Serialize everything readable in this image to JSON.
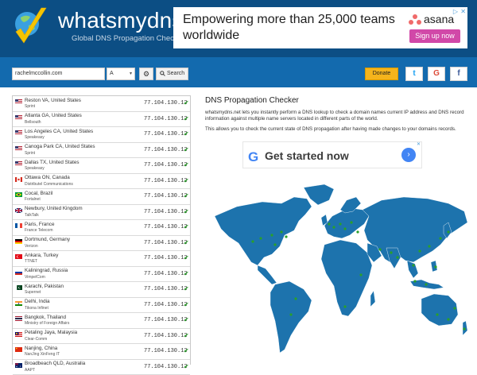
{
  "site": {
    "title": "whatsmydns.net",
    "subtitle": "Global DNS Propagation Checker"
  },
  "ad_top": {
    "text": "Empowering more than 25,000 teams worldwide",
    "brand": "asana",
    "button": "Sign up now",
    "close": "✕",
    "info": "▷"
  },
  "search": {
    "domain_value": "rachelmccollin.com",
    "record_type": "A",
    "search_label": "Search",
    "donate_label": "Donate"
  },
  "social": {
    "twitter": "t",
    "google": "G",
    "facebook": "f"
  },
  "results": [
    {
      "location": "Reston VA, United States",
      "isp": "Sprint",
      "flag": "us",
      "ip": "77.104.130.12"
    },
    {
      "location": "Atlanta GA, United States",
      "isp": "Bellsouth",
      "flag": "us",
      "ip": "77.104.130.12"
    },
    {
      "location": "Los Angeles CA, United States",
      "isp": "Speakeasy",
      "flag": "us",
      "ip": "77.104.130.12"
    },
    {
      "location": "Canoga Park CA, United States",
      "isp": "Sprint",
      "flag": "us",
      "ip": "77.104.130.12"
    },
    {
      "location": "Dallas TX, United States",
      "isp": "Speakeasy",
      "flag": "us",
      "ip": "77.104.130.12"
    },
    {
      "location": "Ottawa ON, Canada",
      "isp": "Distributel Communications",
      "flag": "ca",
      "ip": "77.104.130.12"
    },
    {
      "location": "Cocal, Brazil",
      "isp": "Fortalnet",
      "flag": "br",
      "ip": "77.104.130.12"
    },
    {
      "location": "Newbury, United Kingdom",
      "isp": "TalkTalk",
      "flag": "gb",
      "ip": "77.104.130.12"
    },
    {
      "location": "Paris, France",
      "isp": "France Telecom",
      "flag": "fr",
      "ip": "77.104.130.12"
    },
    {
      "location": "Dortmund, Germany",
      "isp": "Verizon",
      "flag": "de",
      "ip": "77.104.130.12"
    },
    {
      "location": "Ankara, Turkey",
      "isp": "TTNET",
      "flag": "tr",
      "ip": "77.104.130.12"
    },
    {
      "location": "Kaliningrad, Russia",
      "isp": "VimpelCom",
      "flag": "ru",
      "ip": "77.104.130.12"
    },
    {
      "location": "Karachi, Pakistan",
      "isp": "Supernet",
      "flag": "pk",
      "ip": "77.104.130.12"
    },
    {
      "location": "Delhi, India",
      "isp": "Tikona Infinet",
      "flag": "in",
      "ip": "77.104.130.12"
    },
    {
      "location": "Bangkok, Thailand",
      "isp": "Ministry of Foreign Affairs",
      "flag": "th",
      "ip": "77.104.130.12"
    },
    {
      "location": "Petaling Jaya, Malaysia",
      "isp": "Clear-Comm",
      "flag": "my",
      "ip": "77.104.130.12"
    },
    {
      "location": "Nanjing, China",
      "isp": "NanJing XinFeng IT",
      "flag": "cn",
      "ip": "77.104.130.12"
    },
    {
      "location": "Broadbeach QLD, Australia",
      "isp": "AAPT",
      "flag": "au",
      "ip": "77.104.130.12"
    }
  ],
  "panel": {
    "title": "DNS Propagation Checker",
    "desc1": "whatsmydns.net lets you instantly perform a DNS lookup to check a domain names current IP address and DNS record information against multiple name servers located in different parts of the world.",
    "desc2": "This allows you to check the current state of DNS propagation after having made changes to your domains records."
  },
  "ad_mid": {
    "brand_letter": "G",
    "text": "Get started now",
    "arrow": "›",
    "close": "✕"
  },
  "colors": {
    "header_bg": "#0c4e84",
    "bar_bg": "#136aae",
    "donate": "#f5b41c",
    "check": "#2aa02a",
    "map_land": "#1d73ad"
  }
}
